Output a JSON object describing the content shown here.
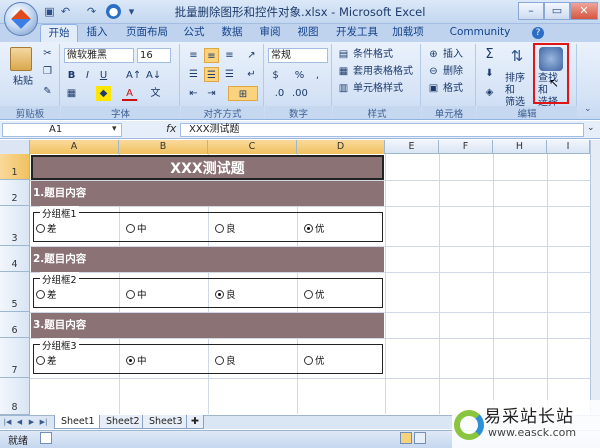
{
  "window": {
    "title": "批量删除图形和控件对象.xlsx - Microsoft Excel"
  },
  "tabs": [
    "开始",
    "插入",
    "页面布局",
    "公式",
    "数据",
    "审阅",
    "视图",
    "开发工具",
    "加载项",
    "Community Clips"
  ],
  "ribbon": {
    "clipboard": {
      "paste": "粘贴",
      "label": "剪贴板"
    },
    "font": {
      "name": "微软雅黑",
      "size": "16",
      "bold": "B",
      "italic": "I",
      "underline": "U",
      "color": "A",
      "label": "字体"
    },
    "alignment": {
      "label": "对齐方式"
    },
    "number": {
      "format": "常规",
      "percent": "%",
      "comma": ",",
      "label": "数字"
    },
    "styles": {
      "conditional": "条件格式",
      "table": "套用表格格式",
      "cell": "单元格样式",
      "label": "样式"
    },
    "cells": {
      "insert": "插入",
      "delete": "删除",
      "format": "格式",
      "label": "单元格"
    },
    "editing": {
      "sum": "Σ",
      "sort": "排序和\n筛选",
      "find": "查找和\n选择",
      "label": "编辑"
    }
  },
  "formula_bar": {
    "name_box": "A1",
    "fx": "fx",
    "content": "XXX测试题"
  },
  "columns": [
    "A",
    "B",
    "C",
    "D",
    "E",
    "F",
    "H",
    "I"
  ],
  "rows": [
    "1",
    "2",
    "3",
    "4",
    "5",
    "6",
    "7",
    "8"
  ],
  "sheet": {
    "title": "XXX测试题",
    "sections": [
      {
        "heading": "1.题目内容",
        "group": "分组框1",
        "options": [
          "差",
          "中",
          "良",
          "优"
        ],
        "selected": 3
      },
      {
        "heading": "2.题目内容",
        "group": "分组框2",
        "options": [
          "差",
          "中",
          "良",
          "优"
        ],
        "selected": 2
      },
      {
        "heading": "3.题目内容",
        "group": "分组框3",
        "options": [
          "差",
          "中",
          "良",
          "优"
        ],
        "selected": 1
      }
    ]
  },
  "sheet_tabs": [
    "Sheet1",
    "Sheet2",
    "Sheet3"
  ],
  "status": "就绪",
  "watermark": {
    "name": "易采站长站",
    "url": "www.easck.com"
  },
  "colors": {
    "band": "#8b7375",
    "highlight": "#e01515",
    "ribbon": "#d5e3f6"
  }
}
